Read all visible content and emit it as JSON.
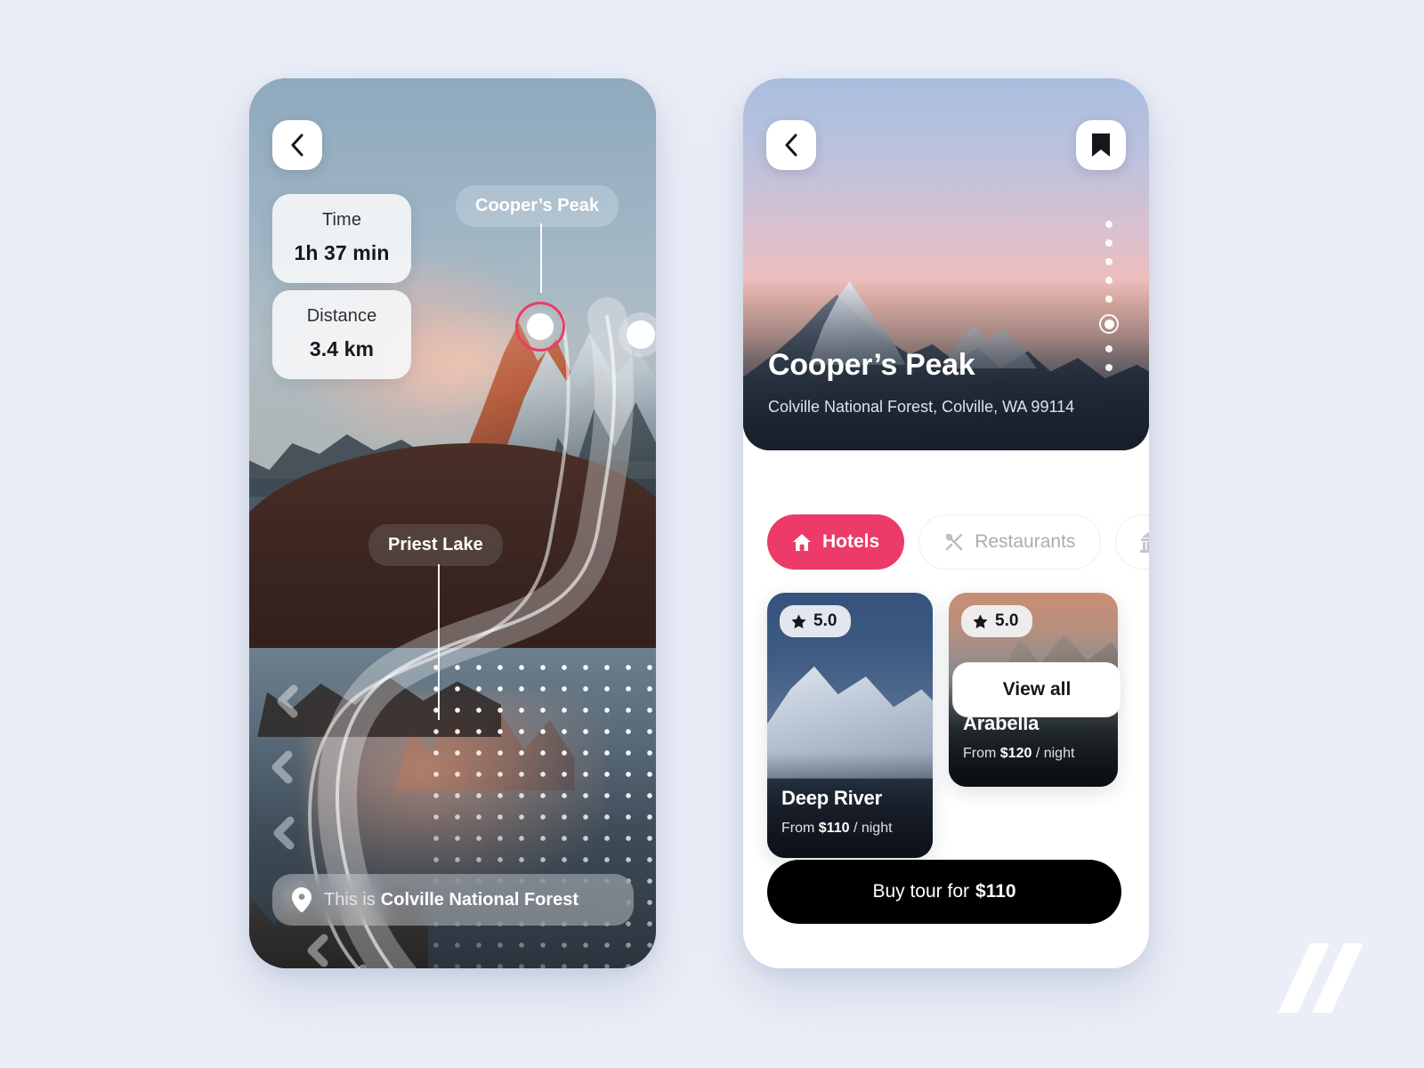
{
  "background_color": "#eaeef7",
  "accent_color": "#ec3b68",
  "left_screen": {
    "name": "route-map-screen",
    "back_button": "back-arrow-icon",
    "stats": [
      {
        "label": "Time",
        "value": "1h 37 min"
      },
      {
        "label": "Distance",
        "value": "3.4 km"
      }
    ],
    "waypoints": [
      {
        "label": "Cooper’s Peak",
        "state": "active"
      },
      {
        "label": "Priest Lake",
        "state": "default"
      }
    ],
    "location_bar": {
      "icon": "map-pin-icon",
      "prefix": "This is",
      "place": "Colville National Forest"
    }
  },
  "right_screen": {
    "name": "place-detail-screen",
    "back_button": "back-arrow-icon",
    "bookmark_button": "bookmark-icon",
    "hero": {
      "title": "Cooper’s Peak",
      "address": "Colville National Forest, Colville, WA 99114",
      "carousel_total": 8,
      "carousel_active_index": 6
    },
    "filters": [
      {
        "label": "Hotels",
        "icon": "home-icon",
        "selected": true
      },
      {
        "label": "Restaurants",
        "icon": "cutlery-icon",
        "selected": false
      },
      {
        "label": "",
        "icon": "landmark-icon",
        "selected": false
      }
    ],
    "hotels": [
      {
        "name": "Deep River",
        "rating": "5.0",
        "price_prefix": "From",
        "price": "$110",
        "price_suffix": "/ night"
      },
      {
        "name": "Arabella",
        "rating": "5.0",
        "price_prefix": "From",
        "price": "$120",
        "price_suffix": "/ night"
      }
    ],
    "view_all_label": "View all",
    "buy_button": {
      "prefix": "Buy tour for",
      "price": "$110"
    }
  },
  "watermark": {
    "name": "double-slash-logo"
  }
}
